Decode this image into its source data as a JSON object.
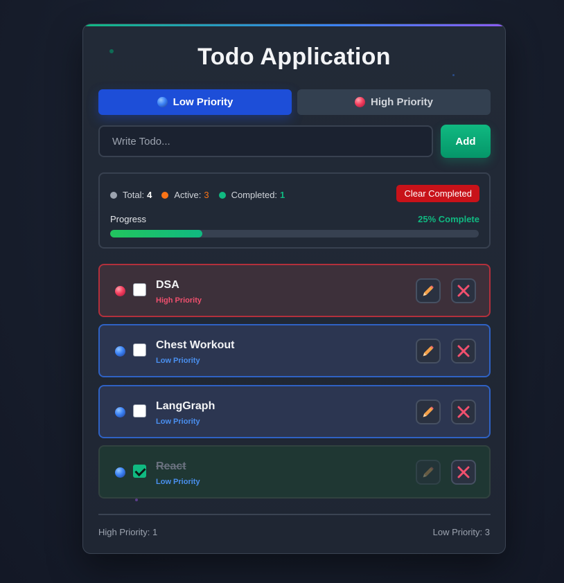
{
  "app": {
    "title": "Todo Application"
  },
  "priority_tabs": [
    {
      "label": "Low Priority",
      "icon": "blue-ball-icon",
      "selected": true
    },
    {
      "label": "High Priority",
      "icon": "red-ball-icon",
      "selected": false
    }
  ],
  "input": {
    "placeholder": "Write Todo...",
    "value": ""
  },
  "add_button": {
    "label": "Add"
  },
  "stats": {
    "total_label": "Total:",
    "total": "4",
    "active_label": "Active:",
    "active": "3",
    "completed_label": "Completed:",
    "completed": "1",
    "clear_button": "Clear Completed"
  },
  "progress": {
    "label": "Progress",
    "percent_text": "25% Complete",
    "fraction": 0.25
  },
  "todos": [
    {
      "title": "DSA",
      "priority_label": "High Priority",
      "priority": "high",
      "completed": false
    },
    {
      "title": "Chest Workout",
      "priority_label": "Low Priority",
      "priority": "low",
      "completed": false
    },
    {
      "title": "LangGraph",
      "priority_label": "Low Priority",
      "priority": "low",
      "completed": false
    },
    {
      "title": "React",
      "priority_label": "Low Priority",
      "priority": "low",
      "completed": true
    }
  ],
  "footer": {
    "high_count": "High Priority: 1",
    "low_count": "Low Priority: 3"
  },
  "colors": {
    "accent_blue": "#1d4ed8",
    "accent_green": "#10b981",
    "danger_red": "#c81219",
    "background": "#161c2a"
  }
}
